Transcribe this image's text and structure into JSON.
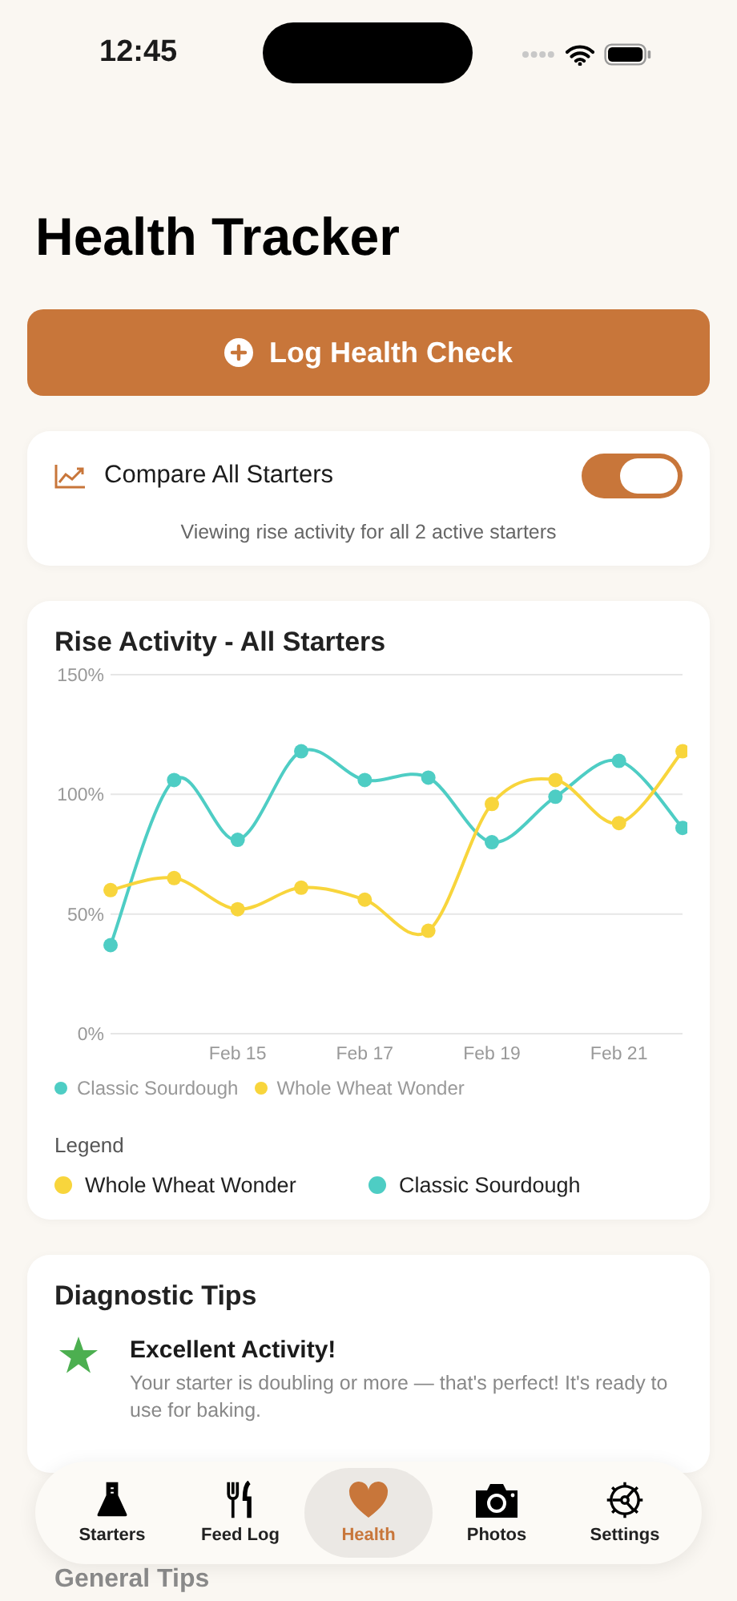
{
  "status_bar": {
    "time": "12:45"
  },
  "title": "Health Tracker",
  "log_button": {
    "label": "Log Health Check"
  },
  "compare": {
    "label": "Compare All Starters",
    "on": true,
    "caption": "Viewing rise activity for all 2 active starters"
  },
  "rise_card": {
    "title": "Rise Activity - All Starters",
    "chart_data": {
      "type": "line",
      "categories": [
        null,
        null,
        "Feb 15",
        null,
        "Feb 17",
        null,
        "Feb 19",
        null,
        "Feb 21",
        null
      ],
      "ylim": [
        0,
        150
      ],
      "yticks": [
        {
          "value": 0,
          "label": "0%"
        },
        {
          "value": 50,
          "label": "50%"
        },
        {
          "value": 100,
          "label": "100%"
        },
        {
          "value": 150,
          "label": "150%"
        }
      ],
      "series": [
        {
          "name": "Classic Sourdough",
          "color": "#4ecdc4",
          "marker": true,
          "values": [
            37,
            106,
            81,
            118,
            106,
            107,
            80,
            99,
            114,
            86
          ]
        },
        {
          "name": "Whole Wheat Wonder",
          "color": "#f8d53c",
          "marker": true,
          "values": [
            60,
            65,
            52,
            61,
            56,
            43,
            96,
            106,
            88,
            118
          ]
        }
      ]
    },
    "legend_title": "Legend",
    "legend": [
      {
        "name": "Whole Wheat Wonder",
        "color": "#f8d53c"
      },
      {
        "name": "Classic Sourdough",
        "color": "#4ecdc4"
      }
    ]
  },
  "tips": {
    "title": "Diagnostic Tips",
    "items": [
      {
        "title": "Excellent Activity!",
        "text": "Your starter is doubling or more — that's perfect! It's ready to use for baking."
      }
    ],
    "next_title": "General Tips"
  },
  "tab_bar": [
    {
      "label": "Starters",
      "kind": "flask",
      "selected": false
    },
    {
      "label": "Feed Log",
      "kind": "cutlery",
      "selected": false
    },
    {
      "label": "Health",
      "kind": "heart",
      "selected": true
    },
    {
      "label": "Photos",
      "kind": "camera",
      "selected": false
    },
    {
      "label": "Settings",
      "kind": "gear",
      "selected": false
    }
  ]
}
